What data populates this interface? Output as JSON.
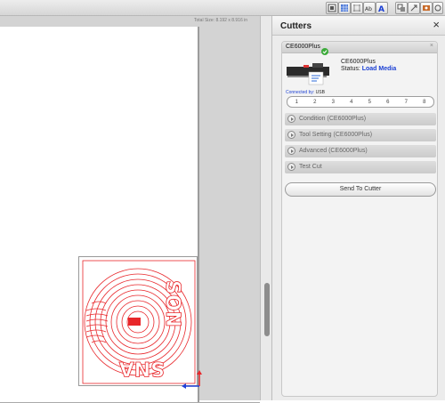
{
  "toolbar": {
    "icons": [
      "fit-page-icon",
      "grid-icon",
      "crop-marks-icon",
      "text-size-icon",
      "font-icon",
      "fill-icon",
      "transform-icon",
      "registration-icon",
      "help-icon"
    ]
  },
  "canvas": {
    "caption": "Total Size: 8.192 x 8.916 in"
  },
  "panel": {
    "title": "Cutters",
    "close_label": "×"
  },
  "cutter": {
    "name": "CE6000Plus",
    "card_close": "×",
    "model": "CE6000Plus",
    "status_label": "Status: ",
    "status_value": "Load Media",
    "connected_label": "Connected by: ",
    "connected_value": "USB",
    "slots": [
      "1",
      "2",
      "3",
      "4",
      "5",
      "6",
      "7",
      "8"
    ]
  },
  "sections": {
    "condition": "Condition (CE6000Plus)",
    "tool_setting": "Tool Setting (CE6000Plus)",
    "advanced": "Advanced (CE6000Plus)",
    "test_cut": "Test Cut"
  },
  "send_button": "Send To Cutter",
  "colors": {
    "accent_blue": "#1a3fd4",
    "design_red": "#e8262a",
    "status_green": "#3cab3a"
  }
}
